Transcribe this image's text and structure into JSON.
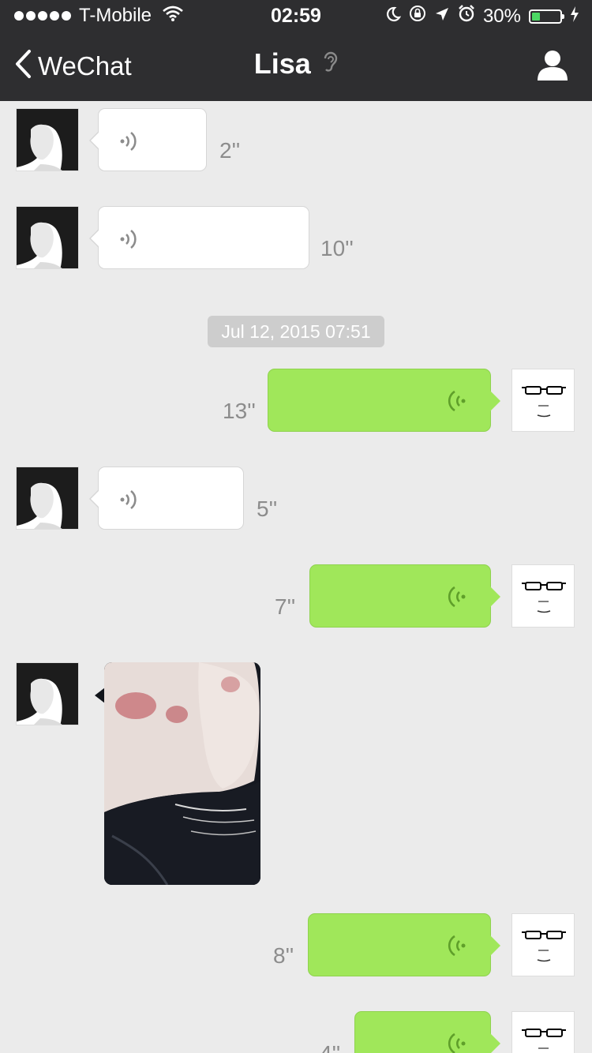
{
  "status": {
    "carrier": "T-Mobile",
    "time": "02:59",
    "battery": "30%",
    "battery_level": 0.3
  },
  "nav": {
    "back_label": "WeChat",
    "title": "Lisa"
  },
  "messages": [
    {
      "from": "Lisa",
      "type": "voice",
      "duration": "2''"
    },
    {
      "from": "Lisa",
      "type": "voice",
      "duration": "10''"
    },
    {
      "type": "timestamp",
      "text": "Jul 12, 2015 07:51"
    },
    {
      "from": "me",
      "type": "voice",
      "duration": "13''"
    },
    {
      "from": "Lisa",
      "type": "voice",
      "duration": "5''"
    },
    {
      "from": "me",
      "type": "voice",
      "duration": "7''"
    },
    {
      "from": "Lisa",
      "type": "photo"
    },
    {
      "from": "me",
      "type": "voice",
      "duration": "8''"
    },
    {
      "from": "me",
      "type": "voice",
      "duration": "4''"
    }
  ],
  "colors": {
    "nav_bg": "#2e2e30",
    "chat_bg": "#ebebeb",
    "outgoing_bubble": "#a0e75a",
    "incoming_bubble": "#ffffff",
    "battery_fill": "#4cd964"
  }
}
